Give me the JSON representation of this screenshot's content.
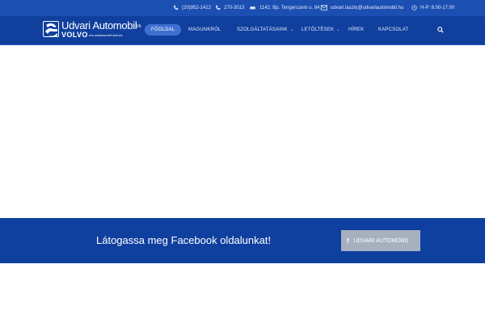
{
  "topbar": {
    "phone1": "(20)952-1412",
    "phone2": "270-3013",
    "address": "1142. Bp. Tengerszem u. 84.",
    "email": "udvari.laszlo@udvariautomobil.hu",
    "hours": "H-P: 8.00-17.00"
  },
  "logo": {
    "title": "Udvari Automobil",
    "suffix": "Kft.",
    "brand": "VOLVO",
    "tagline": "ma szakosodott szerviz"
  },
  "nav": {
    "items": [
      {
        "label": "FŐOLDAL",
        "active": true
      },
      {
        "label": "MAGUNKRÓL"
      },
      {
        "label": "SZOLGÁLTATÁSAINK",
        "has_submenu": true
      },
      {
        "label": "LETÖLTÉSEK",
        "has_submenu": true
      },
      {
        "label": "HÍREK"
      },
      {
        "label": "KAPCSOLAT"
      }
    ],
    "search_icon": "search-icon"
  },
  "facebook_section": {
    "text": "Látogassa meg Facebook oldalunkat!",
    "button_label": "UDVARI AUTOMOBIL",
    "button_icon": "f"
  },
  "colors": {
    "topbar": "#1c4fb2",
    "header": "#103f9e",
    "facebook_section": "#0f409f",
    "active_nav": "#3f6fd0",
    "facebook_button": "#a7b0bf"
  }
}
